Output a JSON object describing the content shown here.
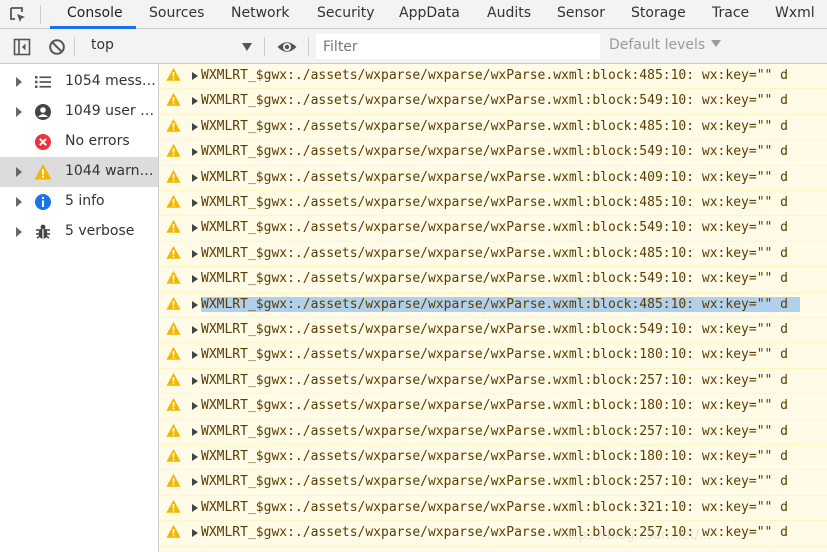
{
  "tabs": [
    {
      "label": "Console",
      "active": true
    },
    {
      "label": "Sources"
    },
    {
      "label": "Network"
    },
    {
      "label": "Security"
    },
    {
      "label": "AppData"
    },
    {
      "label": "Audits"
    },
    {
      "label": "Sensor"
    },
    {
      "label": "Storage"
    },
    {
      "label": "Trace"
    },
    {
      "label": "Wxml"
    }
  ],
  "toolbar": {
    "context": "top",
    "filter_placeholder": "Filter",
    "levels": "Default levels"
  },
  "sidebar": [
    {
      "label": "1054 messa...",
      "icon": "list-icon"
    },
    {
      "label": "1049 user m...",
      "icon": "user-icon"
    },
    {
      "label": "No errors",
      "icon": "error-icon"
    },
    {
      "label": "1044 warnin...",
      "icon": "warning-icon",
      "selected": true
    },
    {
      "label": "5 info",
      "icon": "info-icon"
    },
    {
      "label": "5 verbose",
      "icon": "bug-icon"
    }
  ],
  "log_rows": [
    "WXMLRT_$gwx:./assets/wxparse/wxparse/wxParse.wxml:block:485:10: wx:key=\"\" d",
    "WXMLRT_$gwx:./assets/wxparse/wxparse/wxParse.wxml:block:549:10: wx:key=\"\" d",
    "WXMLRT_$gwx:./assets/wxparse/wxparse/wxParse.wxml:block:485:10: wx:key=\"\" d",
    "WXMLRT_$gwx:./assets/wxparse/wxparse/wxParse.wxml:block:549:10: wx:key=\"\" d",
    "WXMLRT_$gwx:./assets/wxparse/wxparse/wxParse.wxml:block:409:10: wx:key=\"\" d",
    "WXMLRT_$gwx:./assets/wxparse/wxparse/wxParse.wxml:block:485:10: wx:key=\"\" d",
    "WXMLRT_$gwx:./assets/wxparse/wxparse/wxParse.wxml:block:549:10: wx:key=\"\" d",
    "WXMLRT_$gwx:./assets/wxparse/wxparse/wxParse.wxml:block:485:10: wx:key=\"\" d",
    "WXMLRT_$gwx:./assets/wxparse/wxparse/wxParse.wxml:block:549:10: wx:key=\"\" d",
    "WXMLRT_$gwx:./assets/wxparse/wxparse/wxParse.wxml:block:485:10: wx:key=\"\" d",
    "WXMLRT_$gwx:./assets/wxparse/wxparse/wxParse.wxml:block:549:10: wx:key=\"\" d",
    "WXMLRT_$gwx:./assets/wxparse/wxparse/wxParse.wxml:block:180:10: wx:key=\"\" d",
    "WXMLRT_$gwx:./assets/wxparse/wxparse/wxParse.wxml:block:257:10: wx:key=\"\" d",
    "WXMLRT_$gwx:./assets/wxparse/wxparse/wxParse.wxml:block:180:10: wx:key=\"\" d",
    "WXMLRT_$gwx:./assets/wxparse/wxparse/wxParse.wxml:block:257:10: wx:key=\"\" d",
    "WXMLRT_$gwx:./assets/wxparse/wxparse/wxParse.wxml:block:180:10: wx:key=\"\" d",
    "WXMLRT_$gwx:./assets/wxparse/wxparse/wxParse.wxml:block:257:10: wx:key=\"\" d",
    "WXMLRT_$gwx:./assets/wxparse/wxparse/wxParse.wxml:block:321:10: wx:key=\"\" d",
    "WXMLRT_$gwx:./assets/wxparse/wxparse/wxParse.wxml:block:257:10: wx:key=\"\" d"
  ],
  "highlighted_row": 9,
  "colors": {
    "accent": "#1a73e8",
    "warning_bg": "#fffbe6",
    "warning_text": "#5c3c00",
    "warning_icon": "#f2b600",
    "error_icon": "#e8333a",
    "info_icon": "#1a73e8",
    "selection": "#b0d0ec"
  }
}
